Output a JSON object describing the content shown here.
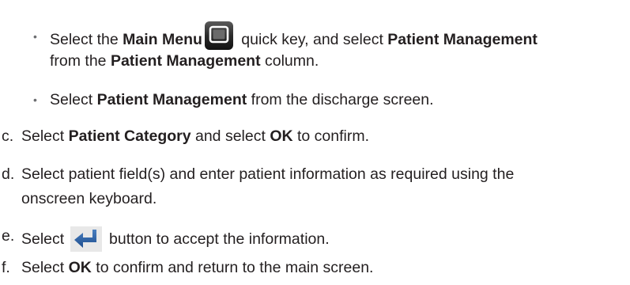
{
  "bullets": [
    {
      "prefix": "Select the ",
      "b1": "Main Menu",
      "mid": " quick key, and select ",
      "b2": "Patient Management",
      "cont_prefix": "from the ",
      "cont_b": "Patient Management",
      "cont_suffix": " column."
    },
    {
      "prefix": "Select ",
      "b1": "Patient Management",
      "suffix": " from the discharge screen."
    }
  ],
  "steps": [
    {
      "letter": "c.",
      "prefix": "Select ",
      "b1": "Patient Category",
      "mid": " and select ",
      "b2": "OK",
      "suffix": " to confirm."
    },
    {
      "letter": "d.",
      "line1": "Select patient field(s) and enter patient information as required using the",
      "line2": "onscreen keyboard."
    },
    {
      "letter": "e.",
      "prefix": "Select ",
      "suffix": " button to accept the information."
    },
    {
      "letter": "f.",
      "prefix": "Select ",
      "b1": "OK",
      "suffix": " to confirm and return to the main screen."
    }
  ],
  "icons": {
    "main_menu": "main-menu-key-icon",
    "enter": "enter-arrow-icon"
  }
}
